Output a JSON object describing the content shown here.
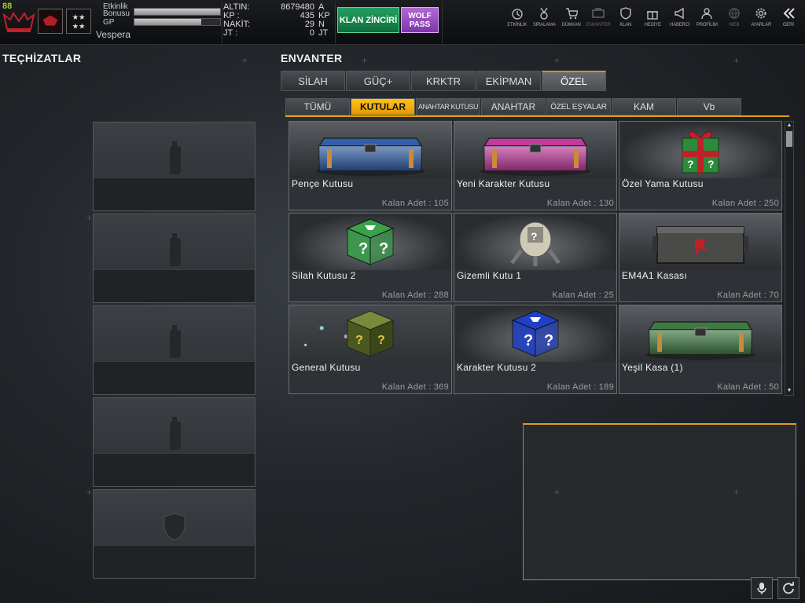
{
  "player": {
    "level": "88",
    "name": "Vespera",
    "event_bonus_label_1": "Etkinlik",
    "event_bonus_label_2": "Bonusu",
    "event_bonus_fill": 1.0,
    "gp_label": "GP",
    "gp_fill": 0.78
  },
  "currency": [
    {
      "label": "ALTIN:",
      "value": "8679480",
      "unit": "A"
    },
    {
      "label": "KP  :",
      "value": "435",
      "unit": "KP"
    },
    {
      "label": "NAKİT:",
      "value": "29",
      "unit": "N"
    },
    {
      "label": "JT  :",
      "value": "0",
      "unit": "JT"
    }
  ],
  "buttons": {
    "klan": "KLAN ZİNCİRİ",
    "wolf_1": "WOLF",
    "wolf_2": "PASS"
  },
  "nav": [
    {
      "label": "ETKİNLİK",
      "icon": "clock-icon"
    },
    {
      "label": "SIRALAMA",
      "icon": "medal-icon"
    },
    {
      "label": "DÜKKAN",
      "icon": "cart-icon"
    },
    {
      "label": "ENVANTER",
      "icon": "inventory-icon"
    },
    {
      "label": "KLAN",
      "icon": "shield-icon"
    },
    {
      "label": "HEDİYE",
      "icon": "gift-icon"
    },
    {
      "label": "HABERCİ",
      "icon": "megaphone-icon"
    },
    {
      "label": "PROFİLİM",
      "icon": "profile-icon"
    },
    {
      "label": "WEB",
      "icon": "globe-icon"
    },
    {
      "label": "AYARLAR",
      "icon": "gear-icon"
    },
    {
      "label": "GERİ",
      "icon": "back-icon"
    }
  ],
  "equipment": {
    "title": "TEÇHİZATLAR"
  },
  "inventory": {
    "title": "ENVANTER",
    "main_tabs": [
      "SİLAH",
      "GÜÇ+",
      "KRKTR",
      "EKİPMAN",
      "ÖZEL"
    ],
    "active_main_tab": 4,
    "sub_tabs": [
      "TÜMÜ",
      "KUTULAR",
      "ANAHTAR KUTUSU",
      "ANAHTAR",
      "ÖZEL EŞYALAR",
      "KAM",
      "Vb"
    ],
    "active_sub_tab": 1,
    "count_label": "Kalan Adet :",
    "items": [
      {
        "name": "Pençe Kutusu",
        "count": "105",
        "color": "#2f5fa8"
      },
      {
        "name": "Yeni Karakter Kutusu",
        "count": "130",
        "color": "#c23a9e"
      },
      {
        "name": "Özel Yama Kutusu",
        "count": "250",
        "color": "#2c8a3a"
      },
      {
        "name": "Silah Kutusu 2",
        "count": "288",
        "color": "#3aa14a"
      },
      {
        "name": "Gizemli Kutu 1",
        "count": "25",
        "color": "#b8b4a4"
      },
      {
        "name": "EM4A1 Kasası",
        "count": "70",
        "color": "#4a4a48"
      },
      {
        "name": "General Kutusu",
        "count": "369",
        "color": "#5a6a2a"
      },
      {
        "name": "Karakter Kutusu 2",
        "count": "189",
        "color": "#1f3fc8"
      },
      {
        "name": "Yeşil Kasa (1)",
        "count": "50",
        "color": "#3f7a42"
      }
    ]
  }
}
